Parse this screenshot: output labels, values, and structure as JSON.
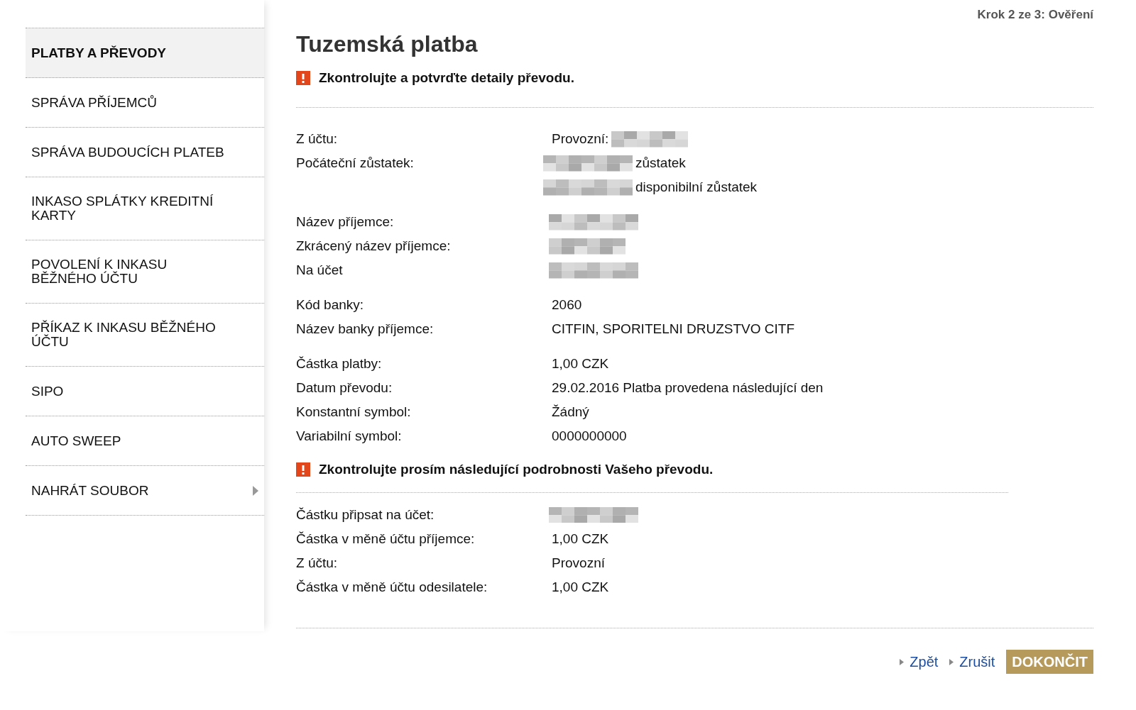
{
  "step": "Krok 2 ze 3: Ověření",
  "sidebar": {
    "items": [
      {
        "label": "PLATBY A PŘEVODY",
        "selected": true
      },
      {
        "label": "SPRÁVA PŘÍJEMCŮ",
        "selected": false
      },
      {
        "label": "SPRÁVA BUDOUCÍCH PLATEB",
        "selected": false
      },
      {
        "label": "INKASO SPLÁTKY KREDITNÍ KARTY",
        "selected": false
      },
      {
        "label": "POVOLENÍ K INKASU BĚŽNÉHO ÚČTU",
        "selected": false
      },
      {
        "label": "PŘÍKAZ K INKASU BĚŽNÉHO ÚČTU",
        "selected": false
      },
      {
        "label": "SIPO",
        "selected": false
      },
      {
        "label": "AUTO SWEEP",
        "selected": false
      },
      {
        "label": "NAHRÁT SOUBOR",
        "selected": false,
        "submenu": true
      }
    ]
  },
  "title": "Tuzemská platba",
  "sections": [
    {
      "alert": "Zkontrolujte a potvrďte detaily převodu.",
      "groups": [
        [
          {
            "label": "Z účtu:",
            "value": "Provozní:",
            "kind": "masked_after"
          },
          {
            "label": "Počáteční zůstatek:",
            "value": "zůstatek",
            "kind": "masked_before"
          },
          {
            "value": "disponibilní zůstatek",
            "kind": "masked_before"
          }
        ],
        [
          {
            "label": "Název příjemce:",
            "kind": "masked"
          },
          {
            "label": "Zkrácený název příjemce:",
            "kind": "masked"
          },
          {
            "label": "Na účet",
            "kind": "masked"
          }
        ],
        [
          {
            "label": "Kód banky:",
            "value": "2060"
          },
          {
            "label": "Název banky příjemce:",
            "value": "CITFIN, SPORITELNI DRUZSTVO CITF"
          }
        ],
        [
          {
            "label": "Částka platby:",
            "value": "1,00 CZK"
          },
          {
            "label": "Datum převodu:",
            "value": "29.02.2016 Platba provedena následující den"
          },
          {
            "label": "Konstantní symbol:",
            "value": "Žádný"
          },
          {
            "label": "Variabilní symbol:",
            "value": "0000000000"
          }
        ]
      ]
    },
    {
      "alert": "Zkontrolujte prosím následující podrobnosti Vašeho převodu.",
      "groups": [
        [
          {
            "label": "Částku připsat na účet:",
            "kind": "masked"
          },
          {
            "label": "Částka v měně účtu příjemce:",
            "value": "1,00 CZK"
          },
          {
            "label": "Z účtu:",
            "value": "Provozní"
          },
          {
            "label": "Částka v měně účtu odesilatele:",
            "value": "1,00 CZK"
          }
        ]
      ]
    }
  ],
  "actions": {
    "links": [
      "Zpět",
      "Zrušit"
    ],
    "primary": "DOKONČIT"
  }
}
